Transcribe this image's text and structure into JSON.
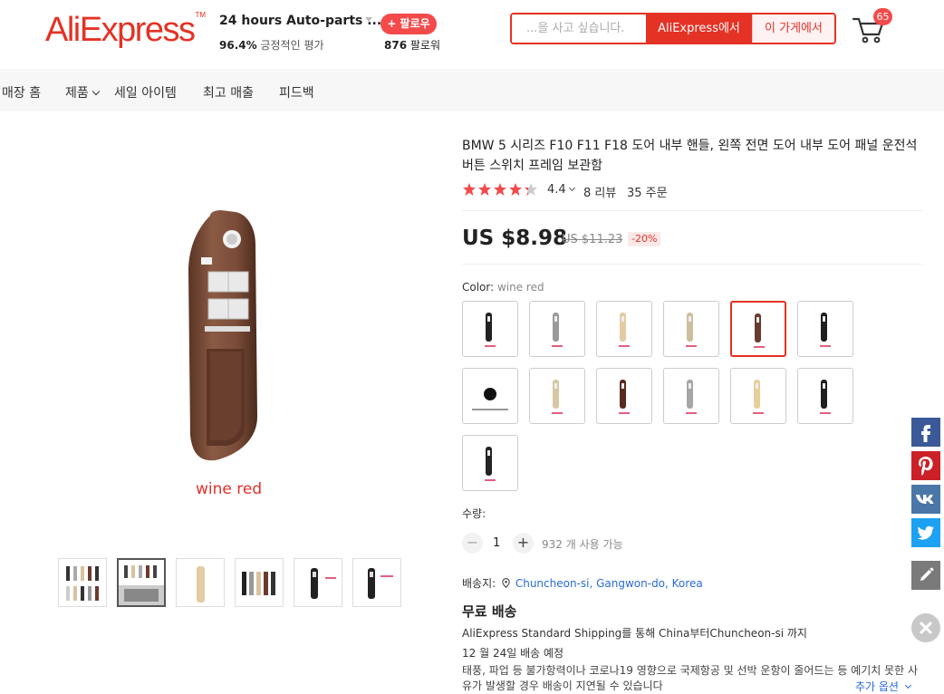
{
  "header": {
    "logo": "AliExpress",
    "store_name": "24 hours Auto-parts ...",
    "follow_label": "+ 팔로우",
    "positive_pct": "96.4%",
    "positive_text": "긍정적인 평가",
    "followers_count": "876",
    "followers_text": "팔로워",
    "search_placeholder": "...을 사고 싶습니다.",
    "search_ae_label": "AliExpress에서",
    "search_store_label": "이 가게에서",
    "cart_count": "65"
  },
  "nav": {
    "items": [
      {
        "label": "매장 홈"
      },
      {
        "label": "제품"
      },
      {
        "label": "세일 아이템"
      },
      {
        "label": "최고 매출"
      },
      {
        "label": "피드백"
      }
    ]
  },
  "gallery": {
    "caption": "wine red",
    "thumbnails": [
      "thumb-1",
      "thumb-2",
      "thumb-3",
      "thumb-4",
      "thumb-5",
      "thumb-6"
    ],
    "active_thumbnail": 2
  },
  "product": {
    "title": "BMW 5 시리즈 F10 F11 F18 도어 내부 핸들, 왼쪽 전면 도어 내부 도어 패널 운전석 버튼 스위치 프레임 보관함",
    "rating": "4.4",
    "reviews": "8 리뷰",
    "orders": "35 주문",
    "price": "US $8.98",
    "old_price": "US $11.23",
    "discount": "-20%",
    "color_label": "Color: ",
    "color_value": "wine red",
    "swatches": [
      {
        "name": "black",
        "tint": "#222222"
      },
      {
        "name": "grey",
        "tint": "#9a9a9a"
      },
      {
        "name": "beige",
        "tint": "#e3cba3"
      },
      {
        "name": "light-beige",
        "tint": "#cbbf9f"
      },
      {
        "name": "wine-red",
        "tint": "#6b3a2e"
      },
      {
        "name": "black-2",
        "tint": "#1e1e1e"
      },
      {
        "name": "switch-part",
        "tint": "#111111"
      },
      {
        "name": "beige-2",
        "tint": "#d8c7a4"
      },
      {
        "name": "wine-red-2",
        "tint": "#5a2a22"
      },
      {
        "name": "grey-2",
        "tint": "#a6a6a6"
      },
      {
        "name": "beige-3",
        "tint": "#e5cf9b"
      },
      {
        "name": "black-3",
        "tint": "#1f1f1f"
      },
      {
        "name": "black-4",
        "tint": "#242424"
      }
    ],
    "selected_swatch": 4,
    "quantity_label": "수량:",
    "quantity": "1",
    "quantity_available": "932 개 사용 가능",
    "ship_to_label": "배송지:",
    "ship_to_location": "Chuncheon-si, Gangwon-do, Korea",
    "free_shipping": "무료 배송",
    "shipping_method": "AliExpress Standard Shipping를 통해 China부터Chuncheon-si 까지",
    "delivery_estimate": "12 월 24일 배송 예정",
    "shipping_note": "태풍, 파업 등 불가항력이나 코로나19 영향으로 국제항공 및 선박 운항이 줄어드는 등 예기치 못한 사유가 발생할 경우 배송이 지연될 수 있습니다",
    "more_options": "추가 옵션"
  },
  "colors": {
    "brand_red": "#e43225",
    "facebook": "#3b5998",
    "pinterest": "#cb2027",
    "vk": "#4a76a8",
    "twitter": "#1da1f2",
    "edit": "#7a7a7a"
  }
}
